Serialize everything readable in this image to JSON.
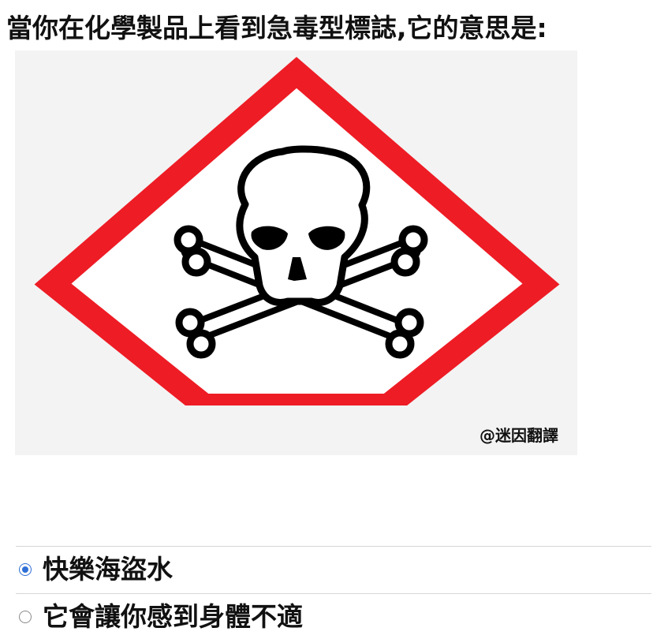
{
  "question": {
    "title": "當你在化學製品上看到急毒型標誌,它的意思是:"
  },
  "image": {
    "icon": "skull-and-crossbones-icon",
    "border_color": "#ee1c25",
    "watermark": "@迷因翻譯"
  },
  "options": [
    {
      "label": "快樂海盜水",
      "selected": true
    },
    {
      "label": "它會讓你感到身體不適",
      "selected": false
    }
  ]
}
